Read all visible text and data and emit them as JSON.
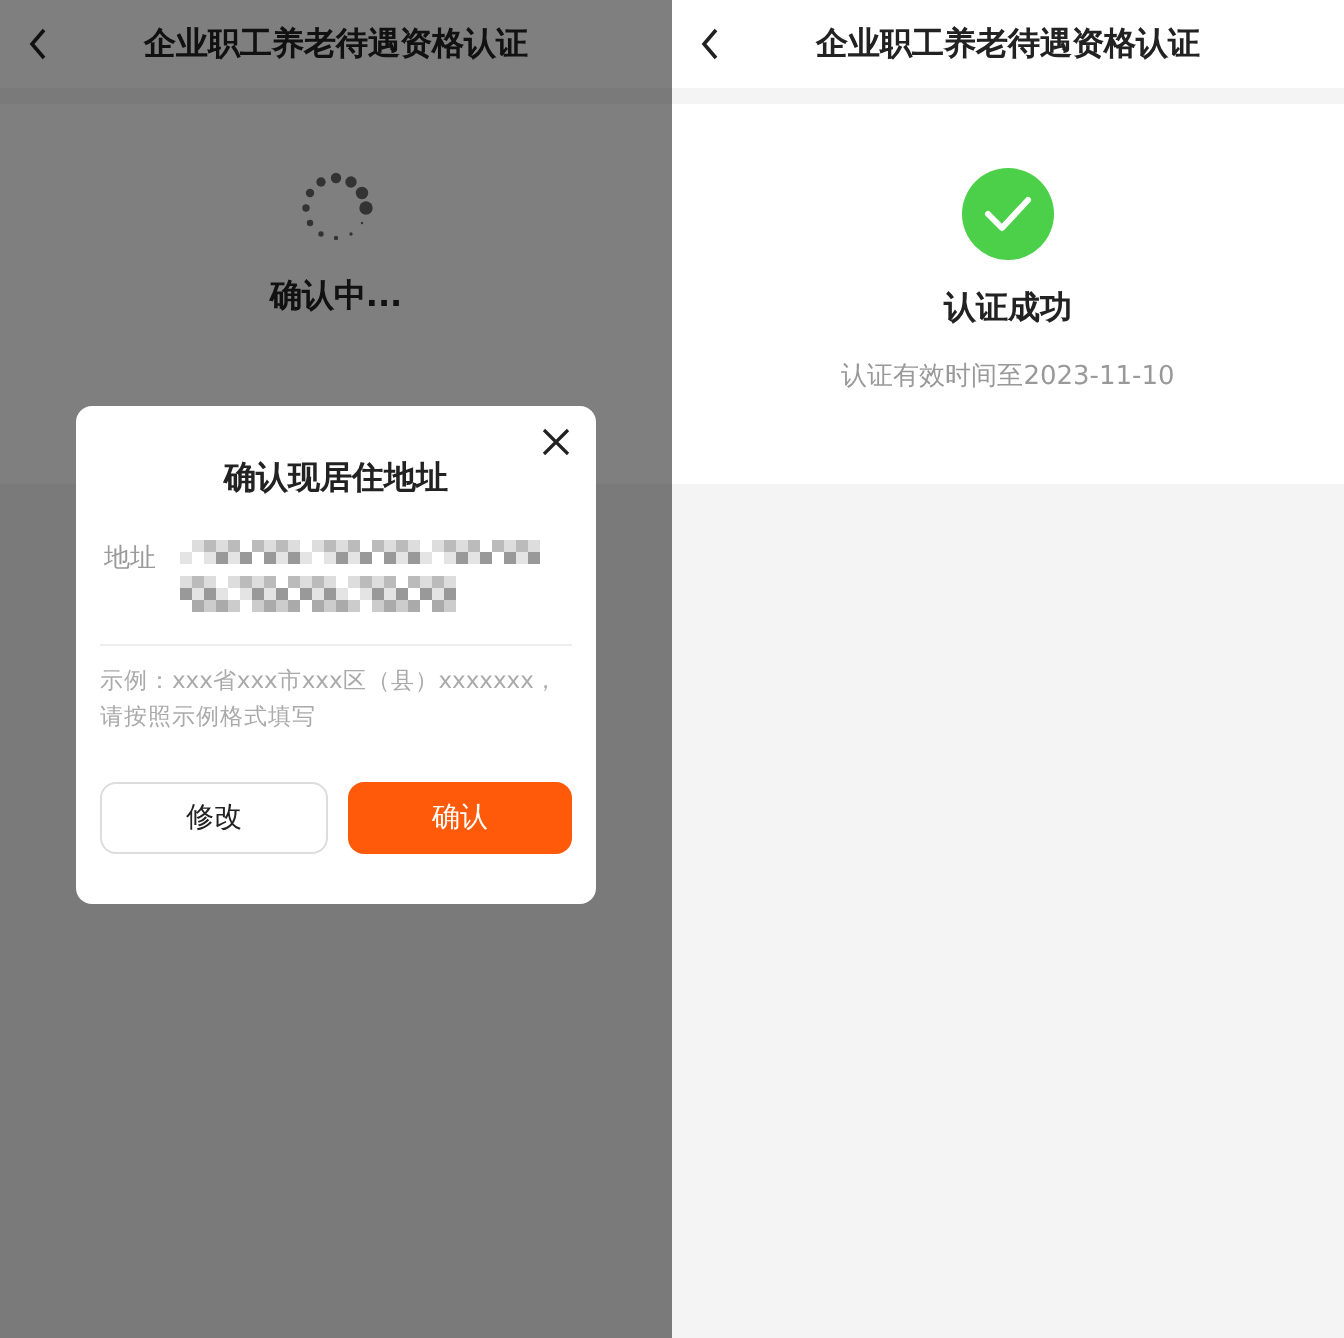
{
  "left_screen": {
    "title": "企业职工养老待遇资格认证",
    "status": "确认中...",
    "dialog": {
      "title": "确认现居住地址",
      "field_label": "地址",
      "hint": "示例：xxx省xxx市xxx区（县）xxxxxxx，请按照示例格式填写",
      "buttons": [
        {
          "label": "修改",
          "kind": "secondary"
        },
        {
          "label": "确认",
          "kind": "primary"
        }
      ]
    }
  },
  "right_screen": {
    "title": "企业职工养老待遇资格认证",
    "result": "认证成功",
    "validity": "认证有效时间至2023-11-10"
  }
}
